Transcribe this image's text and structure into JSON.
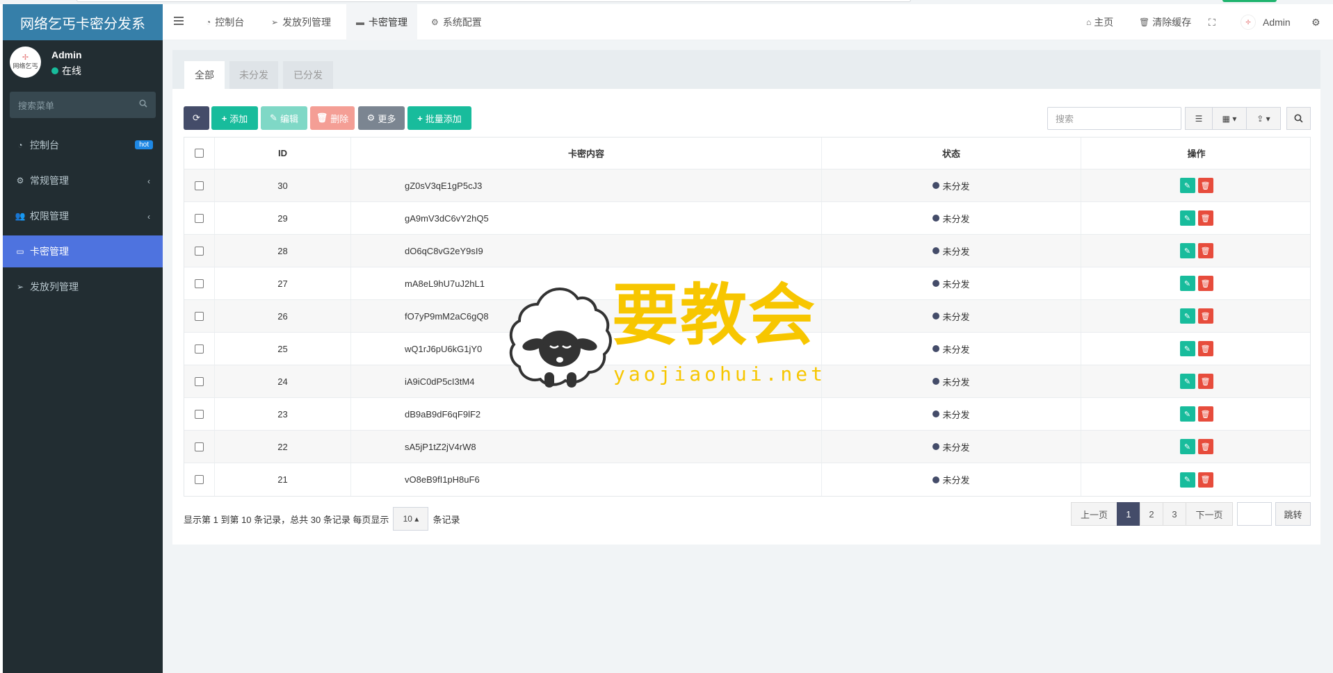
{
  "app": {
    "title": "网络乞丐卡密分发系",
    "avatar_text": "网络乞丐"
  },
  "user": {
    "name": "Admin",
    "status": "在线"
  },
  "sidebar": {
    "search_placeholder": "搜索菜单",
    "items": [
      {
        "label": "控制台",
        "icon": "dashboard-icon",
        "badge": "hot"
      },
      {
        "label": "常规管理",
        "icon": "cogs-icon"
      },
      {
        "label": "权限管理",
        "icon": "users-icon"
      },
      {
        "label": "卡密管理",
        "icon": "card-icon",
        "active": true
      },
      {
        "label": "发放列管理",
        "icon": "paper-plane-icon"
      }
    ]
  },
  "navbar": {
    "tabs": [
      {
        "label": "控制台",
        "icon": "dashboard-icon"
      },
      {
        "label": "发放列管理",
        "icon": "paper-plane-icon"
      },
      {
        "label": "卡密管理",
        "icon": "card-icon",
        "active": true
      },
      {
        "label": "系统配置",
        "icon": "gear-icon"
      }
    ],
    "home": "主页",
    "clear_cache": "清除缓存",
    "admin": "Admin"
  },
  "panel_tabs": [
    "全部",
    "未分发",
    "已分发"
  ],
  "toolbar": {
    "add": "添加",
    "edit": "编辑",
    "delete": "删除",
    "more": "更多",
    "batch_add": "批量添加",
    "search_placeholder": "搜索"
  },
  "table": {
    "columns": [
      "ID",
      "卡密内容",
      "状态",
      "操作"
    ],
    "rows": [
      {
        "id": "30",
        "content": "gZ0sV3qE1gP5cJ3",
        "status": "未分发"
      },
      {
        "id": "29",
        "content": "gA9mV3dC6vY2hQ5",
        "status": "未分发"
      },
      {
        "id": "28",
        "content": "dO6qC8vG2eY9sI9",
        "status": "未分发"
      },
      {
        "id": "27",
        "content": "mA8eL9hU7uJ2hL1",
        "status": "未分发"
      },
      {
        "id": "26",
        "content": "fO7yP9mM2aC6gQ8",
        "status": "未分发"
      },
      {
        "id": "25",
        "content": "wQ1rJ6pU6kG1jY0",
        "status": "未分发"
      },
      {
        "id": "24",
        "content": "iA9iC0dP5cI3tM4",
        "status": "未分发"
      },
      {
        "id": "23",
        "content": "dB9aB9dF6qF9lF2",
        "status": "未分发"
      },
      {
        "id": "22",
        "content": "sA5jP1tZ2jV4rW8",
        "status": "未分发"
      },
      {
        "id": "21",
        "content": "vO8eB9fI1pH8uF6",
        "status": "未分发"
      }
    ]
  },
  "pagination": {
    "info_prefix": "显示第 1 到第 10 条记录，总共 30 条记录 每页显示",
    "page_size": "10",
    "info_suffix": "条记录",
    "prev": "上一页",
    "pages": [
      "1",
      "2",
      "3"
    ],
    "current": "1",
    "next": "下一页",
    "jump": "跳转"
  },
  "watermark": {
    "brand": "要教会",
    "url": "yaojiaohui.net"
  },
  "colors": {
    "sidebar_bg": "#222d32",
    "active_menu": "#4e73df",
    "primary_dark": "#444c69",
    "success": "#18bc9c",
    "danger": "#e74c3c",
    "watermark": "#f7c600"
  }
}
